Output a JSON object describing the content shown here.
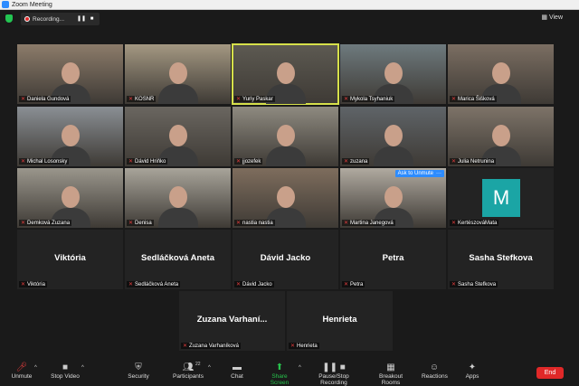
{
  "window": {
    "title": "Zoom Meeting"
  },
  "recording": {
    "label": "Recording..."
  },
  "view": {
    "label": "View"
  },
  "tiles": [
    {
      "name": "Daniela Gundová",
      "kind": "video"
    },
    {
      "name": "KOSNR",
      "kind": "video"
    },
    {
      "name": "Yuriy Paskar",
      "kind": "video",
      "active": true
    },
    {
      "name": "Mykola Tsyhaniuk",
      "kind": "video"
    },
    {
      "name": "Marica Šišková",
      "kind": "video"
    },
    {
      "name": "Michal Losonsky",
      "kind": "video"
    },
    {
      "name": "Dávid Hriňko",
      "kind": "video"
    },
    {
      "name": "jjozefek",
      "kind": "video"
    },
    {
      "name": "zuzana",
      "kind": "video"
    },
    {
      "name": "Julia Netrunina",
      "kind": "video"
    },
    {
      "name": "Demková Zuzana",
      "kind": "video"
    },
    {
      "name": "Denisa",
      "kind": "video"
    },
    {
      "name": "nastia nastia",
      "kind": "video"
    },
    {
      "name": "Martina Janegová",
      "kind": "video",
      "ask_unmute": "Ask to Unmute"
    },
    {
      "name": "KertészováMata",
      "kind": "initial",
      "initial": "M"
    },
    {
      "name": "Viktória",
      "kind": "name",
      "display": "Viktória"
    },
    {
      "name": "Sedláčková Aneta",
      "kind": "name",
      "display": "Sedláčková Aneta"
    },
    {
      "name": "Dávid Jacko",
      "kind": "name",
      "display": "Dávid Jacko"
    },
    {
      "name": "Petra",
      "kind": "name",
      "display": "Petra"
    },
    {
      "name": "Sasha Stefkova",
      "kind": "name",
      "display": "Sasha Stefkova"
    },
    {
      "name": "Zuzana Varhaníková",
      "kind": "name",
      "display": "Zuzana Varhaní..."
    },
    {
      "name": "Henrieta",
      "kind": "name",
      "display": "Henrieta"
    }
  ],
  "toolbar": {
    "unmute": "Unmute",
    "stop_video": "Stop Video",
    "security": "Security",
    "participants": "Participants",
    "participants_count": "22",
    "chat": "Chat",
    "share_screen": "Share Screen",
    "pause_recording": "Pause/Stop Recording",
    "breakout_rooms": "Breakout Rooms",
    "reactions": "Reactions",
    "apps": "Apps",
    "end": "End"
  }
}
